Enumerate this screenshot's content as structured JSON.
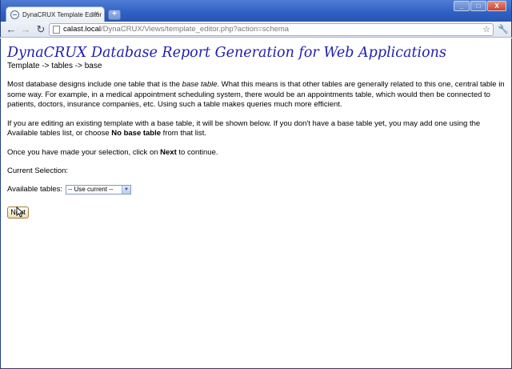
{
  "browser": {
    "tab_title": "DynaCRUX Template Editor",
    "tab_close": "×",
    "new_tab": "+",
    "url_host": "calast.local",
    "url_path": "/DynaCRUX/Views/template_editor.php?action=schema",
    "window_buttons": [
      "_",
      "□",
      "X"
    ]
  },
  "page": {
    "title": "DynaCRUX Database Report Generation for Web Applications",
    "breadcrumb": "Template -> tables -> base",
    "intro_1": "Most database designs include one table that is the ",
    "intro_em": "base table",
    "intro_2": ". What this means is that other tables are generally related to this one, central table in some way. For example, in a medical appointment scheduling system, there would be an appointments table, which would then be connected to patients, doctors, insurance companies, etc. Using such a table makes queries much more efficient.",
    "edit_1": "If you are editing an existing template with a base table, it will be shown below. If you don't have a base table yet, you may add one using the Available tables list, or choose ",
    "edit_bold": "No base table",
    "edit_2": " from that list.",
    "sel_1": "Once you have made your selection, click on ",
    "sel_bold": "Next",
    "sel_2": " to continue.",
    "current_selection": "Current Selection:",
    "available_label": "Available tables:",
    "available_value": "-- Use current --",
    "next_label": "Next"
  }
}
